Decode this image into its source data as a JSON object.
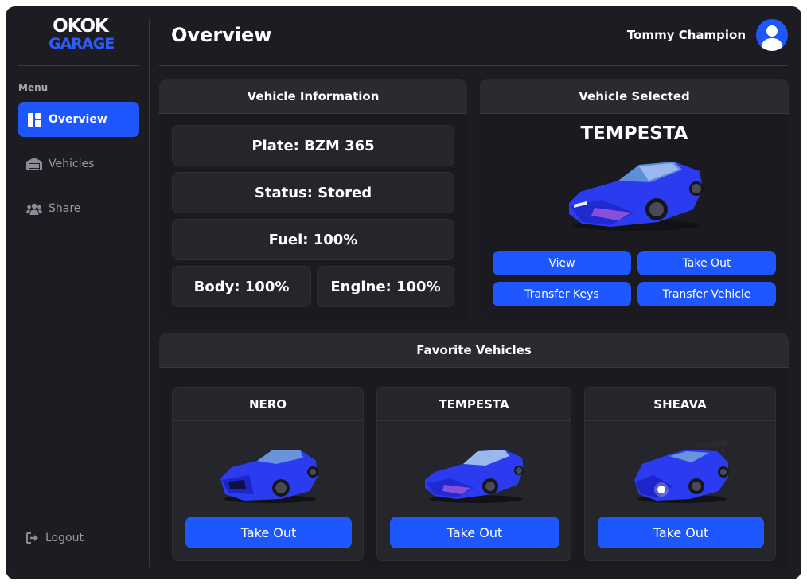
{
  "sidebar": {
    "logo_top": "OKOK",
    "logo_bottom": "GARAGE",
    "menu_label": "Menu",
    "items": [
      {
        "label": "Overview",
        "icon": "dashboard-icon",
        "active": true
      },
      {
        "label": "Vehicles",
        "icon": "garage-icon",
        "active": false
      },
      {
        "label": "Share",
        "icon": "users-icon",
        "active": false
      }
    ],
    "logout_label": "Logout"
  },
  "header": {
    "title": "Overview",
    "user_name": "Tommy Champion"
  },
  "vehicle_info": {
    "title": "Vehicle Information",
    "plate": "Plate: BZM 365",
    "status": "Status: Stored",
    "fuel": "Fuel: 100%",
    "body": "Body: 100%",
    "engine": "Engine: 100%"
  },
  "vehicle_selected": {
    "title": "Vehicle Selected",
    "name": "TEMPESTA",
    "buttons": {
      "view": "View",
      "take_out": "Take Out",
      "transfer_keys": "Transfer Keys",
      "transfer_vehicle": "Transfer Vehicle"
    }
  },
  "favorites": {
    "title": "Favorite Vehicles",
    "cars": [
      {
        "name": "NERO",
        "button": "Take Out"
      },
      {
        "name": "TEMPESTA",
        "button": "Take Out"
      },
      {
        "name": "SHEAVA",
        "button": "Take Out"
      }
    ]
  },
  "colors": {
    "accent": "#1f57ff",
    "background": "#1c1c22",
    "panel_header": "#2a2a31",
    "car_body": "#2b3cf0"
  }
}
